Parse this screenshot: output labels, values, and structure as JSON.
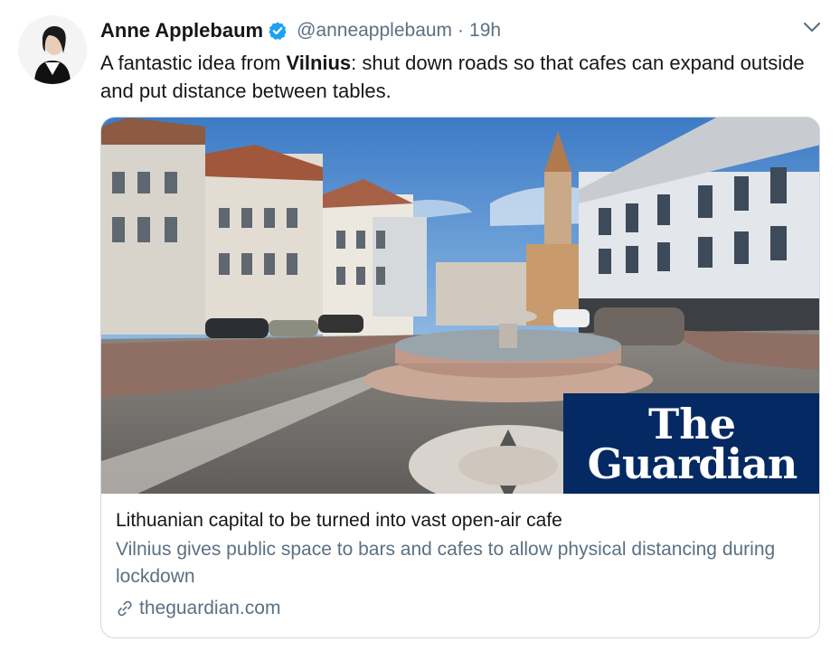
{
  "author": {
    "name": "Anne Applebaum",
    "handle": "@anneapplebaum",
    "separator": "·",
    "time": "19h"
  },
  "tweet": {
    "text_before": "A fantastic idea from ",
    "text_bold": "Vilnius",
    "text_after": ": shut down roads so that cafes can expand outside and put distance between tables."
  },
  "card": {
    "title": "Lithuanian capital to be turned into vast open-air cafe",
    "description": "Vilnius gives public space to bars and cafes to allow physical distancing during lockdown",
    "domain": "theguardian.com",
    "logo_line1": "The",
    "logo_line2": "Guardian"
  },
  "colors": {
    "verified": "#1da1f2",
    "secondary_text": "#5b7083",
    "guardian_blue": "#052962"
  },
  "icons": {
    "verified": "verified-badge-icon",
    "more": "chevron-down-icon",
    "link": "link-icon"
  }
}
